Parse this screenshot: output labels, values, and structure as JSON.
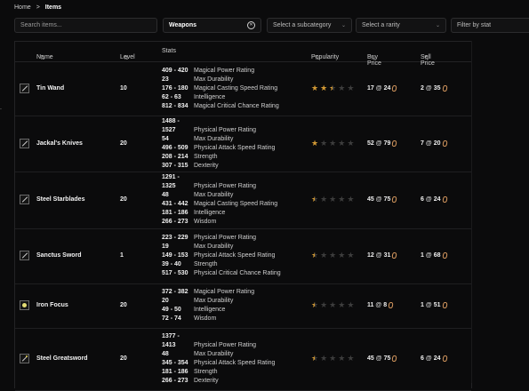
{
  "breadcrumb": {
    "home": "Home",
    "sep": ">",
    "current": "Items"
  },
  "filters": {
    "search_placeholder": "Search items...",
    "category": "Weapons",
    "subcategory_placeholder": "Select a subcategory",
    "rarity_placeholder": "Select a rarity",
    "stat_placeholder": "Filter by stat"
  },
  "table": {
    "headers": {
      "name": "Name",
      "level": "Level",
      "stats": "Stats",
      "popularity": "Popularity",
      "buy": "Buy Price",
      "sell": "Sell Price"
    },
    "rows": [
      {
        "name": "Tin Wand",
        "level": "10",
        "icon": "wand-icon",
        "rating": 2.5,
        "stats": [
          [
            "409 - 420",
            "Magical Power Rating"
          ],
          [
            "23",
            "Max Durability"
          ],
          [
            "176 - 180",
            "Magical Casting Speed Rating"
          ],
          [
            "62 - 63",
            "Intelligence"
          ],
          [
            "812 - 834",
            "Magical Critical Chance Rating"
          ]
        ],
        "buy": {
          "a": "17",
          "b": "24"
        },
        "sell": {
          "a": "2",
          "b": "35"
        }
      },
      {
        "name": "Jackal's Knives",
        "level": "20",
        "icon": "knives-icon",
        "rating": 1,
        "stats": [
          [
            "1488 -",
            ""
          ],
          [
            "1527",
            "Physical Power Rating"
          ],
          [
            "54",
            "Max Durability"
          ],
          [
            "496 - 509",
            "Physical Attack Speed Rating"
          ],
          [
            "208 - 214",
            "Strength"
          ],
          [
            "307 - 315",
            "Dexterity"
          ]
        ],
        "buy": {
          "a": "52",
          "b": "79"
        },
        "sell": {
          "a": "7",
          "b": "20"
        }
      },
      {
        "name": "Steel Starblades",
        "level": "20",
        "icon": "blades-icon",
        "rating": 0.5,
        "stats": [
          [
            "1291 -",
            ""
          ],
          [
            "1325",
            "Physical Power Rating"
          ],
          [
            "48",
            "Max Durability"
          ],
          [
            "431 - 442",
            "Magical Casting Speed Rating"
          ],
          [
            "181 - 186",
            "Intelligence"
          ],
          [
            "266 - 273",
            "Wisdom"
          ]
        ],
        "buy": {
          "a": "45",
          "b": "75"
        },
        "sell": {
          "a": "6",
          "b": "24"
        }
      },
      {
        "name": "Sanctus Sword",
        "level": "1",
        "icon": "sword-icon",
        "rating": 0.5,
        "stats": [
          [
            "223 - 229",
            "Physical Power Rating"
          ],
          [
            "19",
            "Max Durability"
          ],
          [
            "149 - 153",
            "Physical Attack Speed Rating"
          ],
          [
            "39 - 40",
            "Strength"
          ],
          [
            "517 - 530",
            "Physical Critical Chance Rating"
          ]
        ],
        "buy": {
          "a": "12",
          "b": "31"
        },
        "sell": {
          "a": "1",
          "b": "68"
        }
      },
      {
        "name": "Iron Focus",
        "level": "20",
        "icon": "focus-icon",
        "rating": 0.5,
        "stats": [
          [
            "372 - 382",
            "Magical Power Rating"
          ],
          [
            "20",
            "Max Durability"
          ],
          [
            "49 - 50",
            "Intelligence"
          ],
          [
            "72 - 74",
            "Wisdom"
          ]
        ],
        "buy": {
          "a": "11",
          "b": "8"
        },
        "sell": {
          "a": "1",
          "b": "51"
        }
      },
      {
        "name": "Steel Greatsword",
        "level": "20",
        "icon": "greatsword-icon",
        "rating": 0.5,
        "stats": [
          [
            "1377 -",
            ""
          ],
          [
            "1413",
            "Physical Power Rating"
          ],
          [
            "48",
            "Max Durability"
          ],
          [
            "345 - 354",
            "Physical Attack Speed Rating"
          ],
          [
            "181 - 186",
            "Strength"
          ],
          [
            "266 - 273",
            "Dexterity"
          ]
        ],
        "buy": {
          "a": "45",
          "b": "75"
        },
        "sell": {
          "a": "6",
          "b": "24"
        }
      }
    ]
  },
  "side_note": "."
}
